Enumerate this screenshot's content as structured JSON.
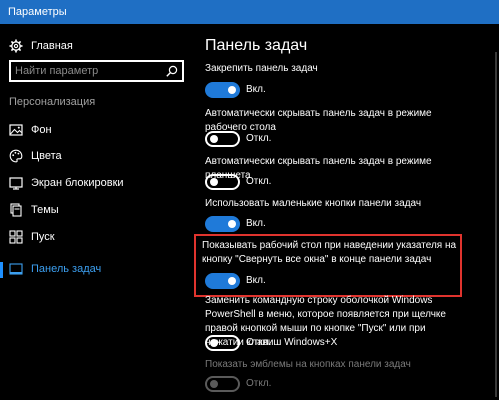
{
  "window": {
    "title": "Параметры"
  },
  "sidebar": {
    "home_label": "Главная",
    "search_placeholder": "Найти параметр",
    "section_label": "Персонализация",
    "items": [
      {
        "label": "Фон",
        "icon": "image-icon"
      },
      {
        "label": "Цвета",
        "icon": "palette-icon"
      },
      {
        "label": "Экран блокировки",
        "icon": "lock-screen-icon"
      },
      {
        "label": "Темы",
        "icon": "themes-icon"
      },
      {
        "label": "Пуск",
        "icon": "start-icon"
      },
      {
        "label": "Панель задач",
        "icon": "taskbar-icon",
        "active": true
      }
    ]
  },
  "main": {
    "title": "Панель задач",
    "settings": [
      {
        "label": "Закрепить панель задач",
        "state": "Вкл.",
        "on": true
      },
      {
        "label": "Автоматически скрывать панель задач в режиме рабочего стола",
        "state": "Откл.",
        "on": false
      },
      {
        "label": "Автоматически скрывать панель задач в режиме планшета",
        "state": "Откл.",
        "on": false
      },
      {
        "label": "Использовать маленькие кнопки панели задач",
        "state": "Вкл.",
        "on": true
      },
      {
        "label": "Показывать рабочий стол при наведении указателя на кнопку \"Свернуть все окна\" в конце панели задач",
        "state": "Вкл.",
        "on": true,
        "highlighted": true
      },
      {
        "label": "Заменить командную строку оболочкой Windows PowerShell в меню, которое появляется при щелчке правой кнопкой мыши по кнопке \"Пуск\" или при нажатии клавиш Windows+X",
        "state": "Откл.",
        "on": false
      },
      {
        "label": "Показать эмблемы на кнопках панели задач",
        "state": "Откл.",
        "on": false,
        "disabled": true
      }
    ]
  },
  "colors": {
    "titlebar": "#1f6fc4",
    "accent": "#1f7ad9",
    "active_text": "#3c9ff0",
    "highlight": "#e0342e",
    "background": "#000000"
  }
}
